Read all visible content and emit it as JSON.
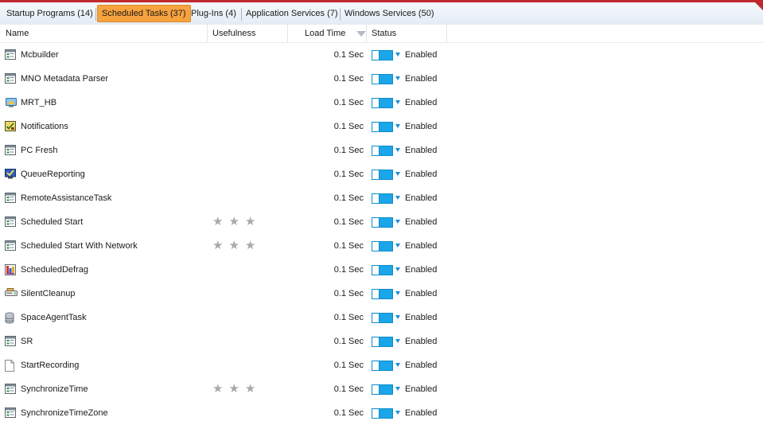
{
  "tabs": [
    {
      "label": "Startup Programs (14)",
      "active": false
    },
    {
      "label": "Scheduled Tasks (37)",
      "active": true
    },
    {
      "label": "Plug-Ins (4)",
      "active": false
    },
    {
      "label": "Application Services (7)",
      "active": false
    },
    {
      "label": "Windows Services (50)",
      "active": false
    }
  ],
  "columns": {
    "name": "Name",
    "usefulness": "Usefulness",
    "load_time": "Load Time",
    "status": "Status"
  },
  "colors": {
    "active_tab": "#f6a23e",
    "toggle_on": "#1aa6e8",
    "top_bar": "#c0282d"
  },
  "rows": [
    {
      "name": "Mcbuilder",
      "icon": "window-task-icon",
      "stars": 0,
      "load_time": "0.1 Sec",
      "status": "Enabled"
    },
    {
      "name": "MNO Metadata Parser",
      "icon": "window-task-icon",
      "stars": 0,
      "load_time": "0.1 Sec",
      "status": "Enabled"
    },
    {
      "name": "MRT_HB",
      "icon": "mrt-shield-icon",
      "stars": 0,
      "load_time": "0.1 Sec",
      "status": "Enabled"
    },
    {
      "name": "Notifications",
      "icon": "notification-icon",
      "stars": 0,
      "load_time": "0.1 Sec",
      "status": "Enabled"
    },
    {
      "name": "PC Fresh",
      "icon": "window-task-icon",
      "stars": 0,
      "load_time": "0.1 Sec",
      "status": "Enabled"
    },
    {
      "name": "QueueReporting",
      "icon": "monitor-check-icon",
      "stars": 0,
      "load_time": "0.1 Sec",
      "status": "Enabled"
    },
    {
      "name": "RemoteAssistanceTask",
      "icon": "window-task-icon",
      "stars": 0,
      "load_time": "0.1 Sec",
      "status": "Enabled"
    },
    {
      "name": "Scheduled Start",
      "icon": "window-task-icon",
      "stars": 3,
      "load_time": "0.1 Sec",
      "status": "Enabled"
    },
    {
      "name": "Scheduled Start With Network",
      "icon": "window-task-icon",
      "stars": 3,
      "load_time": "0.1 Sec",
      "status": "Enabled"
    },
    {
      "name": "ScheduledDefrag",
      "icon": "defrag-icon",
      "stars": 0,
      "load_time": "0.1 Sec",
      "status": "Enabled"
    },
    {
      "name": "SilentCleanup",
      "icon": "drive-icon",
      "stars": 0,
      "load_time": "0.1 Sec",
      "status": "Enabled"
    },
    {
      "name": "SpaceAgentTask",
      "icon": "storage-stack-icon",
      "stars": 0,
      "load_time": "0.1 Sec",
      "status": "Enabled"
    },
    {
      "name": "SR",
      "icon": "window-task-icon",
      "stars": 0,
      "load_time": "0.1 Sec",
      "status": "Enabled"
    },
    {
      "name": "StartRecording",
      "icon": "blank-document-icon",
      "stars": 0,
      "load_time": "0.1 Sec",
      "status": "Enabled"
    },
    {
      "name": "SynchronizeTime",
      "icon": "window-task-icon",
      "stars": 3,
      "load_time": "0.1 Sec",
      "status": "Enabled"
    },
    {
      "name": "SynchronizeTimeZone",
      "icon": "window-task-icon",
      "stars": 0,
      "load_time": "0.1 Sec",
      "status": "Enabled"
    }
  ]
}
